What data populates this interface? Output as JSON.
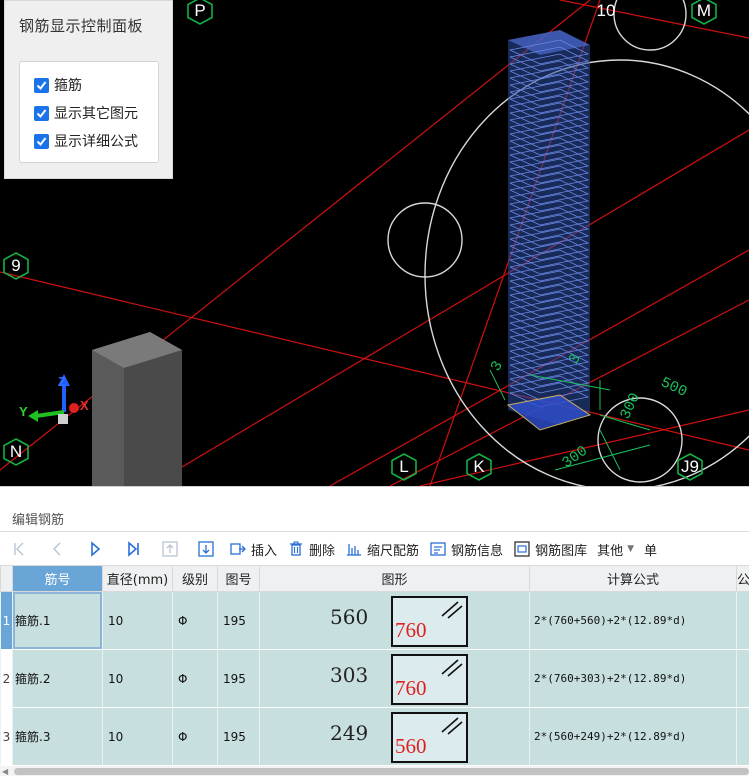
{
  "viewport": {
    "grid_labels": [
      "P",
      "10",
      "M",
      "9",
      "N",
      "L",
      "K",
      "J9"
    ],
    "dimension_labels": [
      "500",
      "300",
      "300",
      "3",
      "3"
    ],
    "axes": {
      "x": "X",
      "y": "Y",
      "z": "Z"
    }
  },
  "control_panel": {
    "title": "钢筋显示控制面板",
    "options": [
      {
        "label": "箍筋",
        "checked": true
      },
      {
        "label": "显示其它图元",
        "checked": true
      },
      {
        "label": "显示详细公式",
        "checked": true
      }
    ]
  },
  "edit_panel": {
    "title": "编辑钢筋",
    "toolbar": {
      "insert": "插入",
      "delete": "删除",
      "scale_rebar": "缩尺配筋",
      "rebar_info": "钢筋信息",
      "rebar_library": "钢筋图库",
      "other": "其他",
      "single": "单"
    },
    "columns": [
      "筋号",
      "直径(mm)",
      "级别",
      "图号",
      "图形",
      "计算公式",
      "公"
    ],
    "rows": [
      {
        "index": "1",
        "name": "箍筋.1",
        "diameter": "10",
        "grade": "Φ",
        "figure_no": "195",
        "dim": "560",
        "box_label": "760",
        "formula": "2*(760+560)+2*(12.89*d)"
      },
      {
        "index": "2",
        "name": "箍筋.2",
        "diameter": "10",
        "grade": "Φ",
        "figure_no": "195",
        "dim": "303",
        "box_label": "760",
        "formula": "2*(760+303)+2*(12.89*d)"
      },
      {
        "index": "3",
        "name": "箍筋.3",
        "diameter": "10",
        "grade": "Φ",
        "figure_no": "195",
        "dim": "249",
        "box_label": "560",
        "formula": "2*(560+249)+2*(12.89*d)"
      }
    ]
  }
}
